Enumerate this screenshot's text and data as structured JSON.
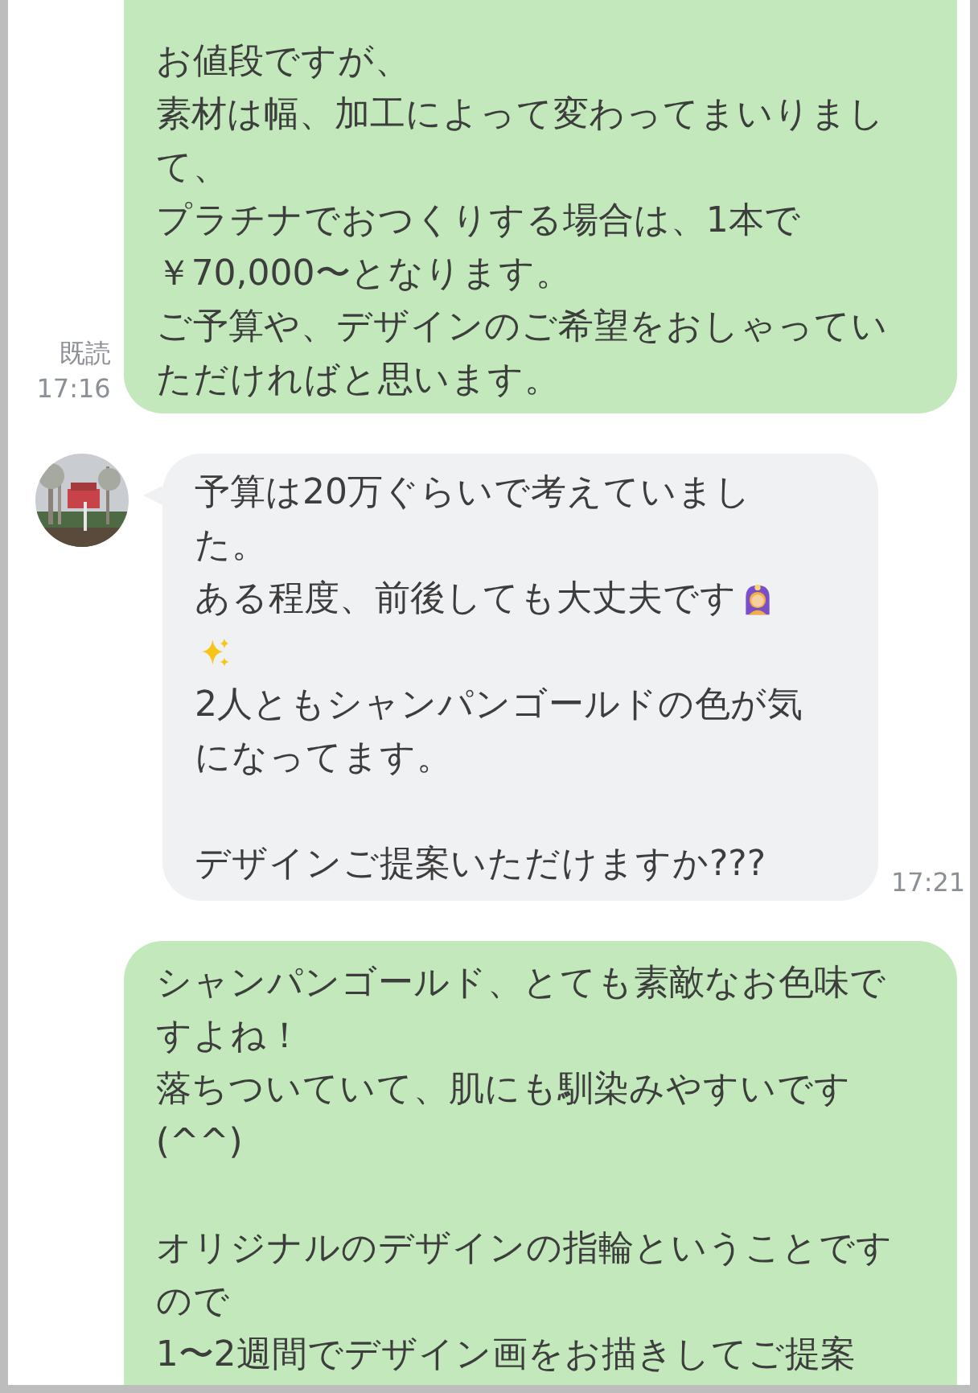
{
  "messages": [
    {
      "kind": "sent",
      "cut_top": true,
      "lines": [
        {
          "kind": "text",
          "text": "お値段ですが、"
        },
        {
          "kind": "text",
          "text": "素材は幅、加工によって変わってまいりまし"
        },
        {
          "kind": "text",
          "text": "て、"
        },
        {
          "kind": "text",
          "text": "プラチナでおつくりする場合は、1本で"
        },
        {
          "kind": "text",
          "text": "￥70,000〜となります。"
        },
        {
          "kind": "text",
          "text": "ご予算や、デザインのご希望をおしゃってい"
        },
        {
          "kind": "text",
          "text": "ただければと思います。"
        }
      ],
      "read": "既読",
      "time": "17:16"
    },
    {
      "kind": "received",
      "lines": [
        {
          "kind": "text",
          "text": "予算は20万ぐらいで考えていまし"
        },
        {
          "kind": "text",
          "text": "た。"
        },
        {
          "kind": "text-ok-gesture",
          "text": "ある程度、前後しても大丈夫です"
        },
        {
          "kind": "sparkles"
        },
        {
          "kind": "text",
          "text": "2人ともシャンパンゴールドの色が気"
        },
        {
          "kind": "text",
          "text": "になってます。"
        },
        {
          "kind": "blank"
        },
        {
          "kind": "text",
          "text": "デザインご提案いただけますか???"
        }
      ],
      "time": "17:21"
    },
    {
      "kind": "sent",
      "cut_bottom": true,
      "lines": [
        {
          "kind": "text",
          "text": "シャンパンゴールド、とても素敵なお色味で"
        },
        {
          "kind": "text",
          "text": "すよね！"
        },
        {
          "kind": "text",
          "text": "落ちついていて、肌にも馴染みやすいです"
        },
        {
          "kind": "text",
          "text": "(^^)"
        },
        {
          "kind": "blank"
        },
        {
          "kind": "text",
          "text": "オリジナルのデザインの指輪ということです"
        },
        {
          "kind": "text",
          "text": "ので"
        },
        {
          "kind": "text",
          "text": "1〜2週間でデザイン画をお描きしてご提案"
        }
      ]
    }
  ]
}
